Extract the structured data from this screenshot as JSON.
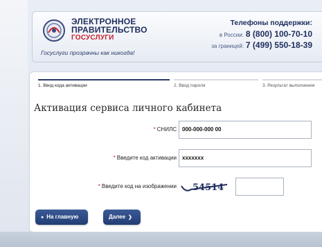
{
  "header": {
    "brand_line1": "ЭЛЕКТРОННОЕ",
    "brand_line2": "ПРАВИТЕЛЬСТВО",
    "brand_line3": "ГОСУСЛУГИ",
    "slogan": "Госуслуги прозрачны как никогда!",
    "support_title": "Телефоны поддержки:",
    "russia_label": "в России:",
    "russia_phone": "8 (800) 100-70-10",
    "abroad_label": "за границей:",
    "abroad_phone": "7 (499) 550-18-39"
  },
  "steps": [
    {
      "label": "1. Ввод кода активации",
      "active": true
    },
    {
      "label": "2. Ввод пароля",
      "active": false
    },
    {
      "label": "3. Результат выполнения",
      "active": false
    }
  ],
  "form": {
    "title": "Активация сервиса личного кабинета",
    "snils_label": "СНИЛС",
    "snils_value": "000-000-000 00",
    "code_label": "Введите код активации",
    "code_value": "xxxxxxx",
    "captcha_label": "Введите код на изображении",
    "captcha_text": "54514",
    "captcha_value": ""
  },
  "buttons": {
    "home": "На главную",
    "next": "Далее"
  },
  "colors": {
    "brand_blue": "#1e2d5c",
    "brand_red": "#c8202c",
    "button_blue": "#2a4a86"
  }
}
